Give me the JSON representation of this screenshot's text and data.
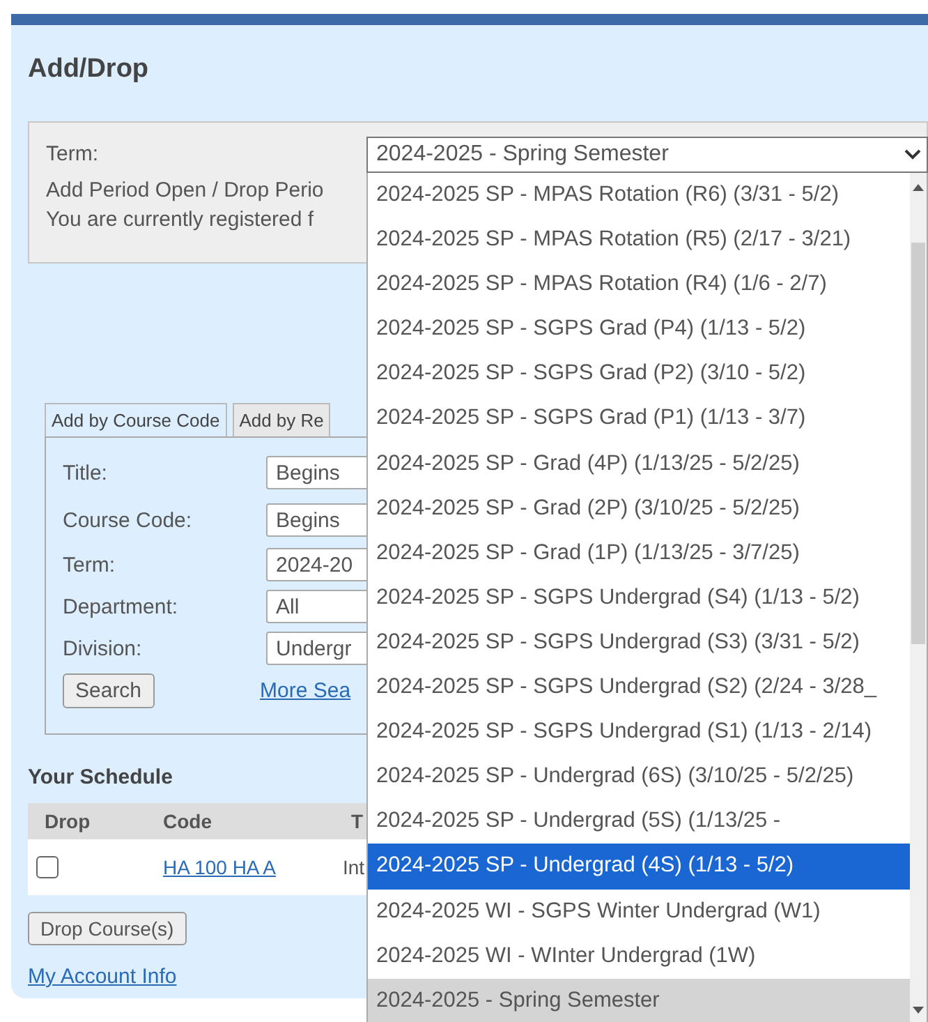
{
  "page_title": "Add/Drop",
  "term_box": {
    "label": "Term:",
    "lines": [
      "Add Period Open / Drop Perio",
      "You are currently registered f"
    ]
  },
  "term_select": {
    "value": "2024-2025 - Spring Semester",
    "options": [
      {
        "label": "2024-2025 SP - MPAS Rotation (R6) (3/31 - 5/2)",
        "selected": false,
        "highlighted": false
      },
      {
        "label": "2024-2025 SP - MPAS Rotation (R5) (2/17 - 3/21)",
        "selected": false,
        "highlighted": false
      },
      {
        "label": "2024-2025 SP - MPAS Rotation (R4) (1/6 - 2/7)",
        "selected": false,
        "highlighted": false
      },
      {
        "label": "2024-2025 SP - SGPS Grad (P4) (1/13 - 5/2)",
        "selected": false,
        "highlighted": false
      },
      {
        "label": "2024-2025 SP - SGPS Grad (P2) (3/10 - 5/2)",
        "selected": false,
        "highlighted": false
      },
      {
        "label": "2024-2025 SP - SGPS Grad (P1) (1/13 - 3/7)",
        "selected": false,
        "highlighted": false
      },
      {
        "label": "2024-2025 SP - Grad (4P) (1/13/25 - 5/2/25)",
        "selected": false,
        "highlighted": false
      },
      {
        "label": "2024-2025 SP - Grad (2P) (3/10/25 - 5/2/25)",
        "selected": false,
        "highlighted": false
      },
      {
        "label": "2024-2025 SP - Grad (1P) (1/13/25 - 3/7/25)",
        "selected": false,
        "highlighted": false
      },
      {
        "label": "2024-2025 SP - SGPS Undergrad (S4) (1/13 - 5/2)",
        "selected": false,
        "highlighted": false
      },
      {
        "label": "2024-2025 SP - SGPS Undergrad (S3) (3/31 - 5/2)",
        "selected": false,
        "highlighted": false
      },
      {
        "label": "2024-2025 SP - SGPS Undergrad (S2) (2/24 - 3/28_",
        "selected": false,
        "highlighted": false
      },
      {
        "label": "2024-2025 SP - SGPS Undergrad (S1) (1/13 - 2/14)",
        "selected": false,
        "highlighted": false
      },
      {
        "label": "2024-2025 SP - Undergrad (6S) (3/10/25 - 5/2/25)",
        "selected": false,
        "highlighted": false
      },
      {
        "label": "2024-2025 SP - Undergrad (5S) (1/13/25 -",
        "selected": false,
        "highlighted": false
      },
      {
        "label": "2024-2025 SP - Undergrad (4S) (1/13 - 5/2)",
        "selected": false,
        "highlighted": true
      },
      {
        "label": "2024-2025 WI - SGPS Winter Undergrad (W1)",
        "selected": false,
        "highlighted": false
      },
      {
        "label": "2024-2025 WI - WInter Undergrad (1W)",
        "selected": false,
        "highlighted": false
      },
      {
        "label": "2024-2025 - Spring Semester",
        "selected": true,
        "highlighted": false
      }
    ]
  },
  "search_tabs": [
    {
      "label": "Add by Course Code",
      "selected": true
    },
    {
      "label": "Add by Re",
      "selected": false
    }
  ],
  "search_form": {
    "fields": [
      {
        "label": "Title:",
        "value": "Begins"
      },
      {
        "label": "Course Code:",
        "value": "Begins"
      },
      {
        "label": "Term:",
        "value": "2024-20"
      },
      {
        "label": "Department:",
        "value": "All"
      },
      {
        "label": "Division:",
        "value": "Undergr"
      }
    ],
    "search_button": "Search",
    "more_link": "More Sea"
  },
  "schedule": {
    "title": "Your Schedule",
    "columns": [
      "Drop",
      "Code",
      "T"
    ],
    "rows": [
      {
        "drop": false,
        "code": "HA 100 HA A",
        "column_3": "Int"
      }
    ]
  },
  "drop_button": "Drop Course(s)",
  "account_link": "My Account Info"
}
